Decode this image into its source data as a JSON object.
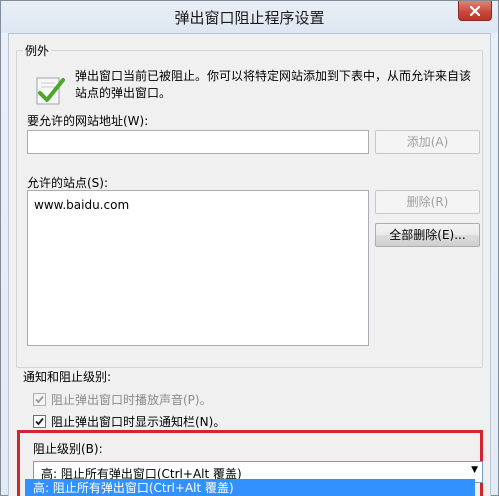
{
  "window": {
    "title": "弹出窗口阻止程序设置"
  },
  "exceptions": {
    "group_label": "例外",
    "info_text": "弹出窗口当前已被阻止。你可以将特定网站添加到下表中，从而允许来自该站点的弹出窗口。",
    "address_label": "要允许的网站地址(W):",
    "address_value": "",
    "add_button": "添加(A)",
    "allowed_label": "允许的站点(S):",
    "allowed_sites": [
      "www.baidu.com"
    ],
    "remove_button": "删除(R)",
    "remove_all_button": "全部删除(E)..."
  },
  "notifications": {
    "group_label": "通知和阻止级别:",
    "play_sound": {
      "label": "阻止弹出窗口时播放声音(P)。",
      "checked": true,
      "enabled": false
    },
    "show_bar": {
      "label": "阻止弹出窗口时显示通知栏(N)。",
      "checked": true,
      "enabled": true
    },
    "level_label": "阻止级别(B):",
    "level_value": "高: 阻止所有弹出窗口(Ctrl+Alt 覆盖)",
    "dropdown_option": "高: 阻止所有弹出窗口(Ctrl+Alt 覆盖)"
  },
  "colors": {
    "highlight_border": "#d4242d",
    "selection": "#3390ff"
  }
}
